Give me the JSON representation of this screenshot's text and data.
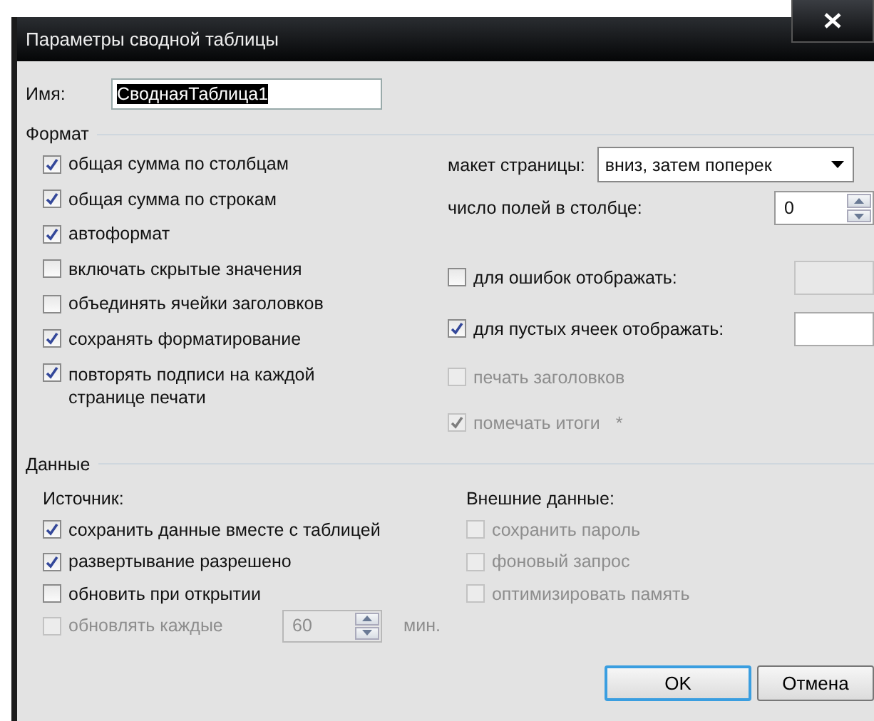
{
  "window": {
    "title": "Параметры сводной таблицы"
  },
  "name_field": {
    "label": "Имя:",
    "value": "СводнаяТаблица1",
    "selected": true
  },
  "format": {
    "title": "Формат",
    "left_options": [
      {
        "label": "общая сумма по столбцам",
        "checked": true,
        "disabled": false
      },
      {
        "label": "общая сумма по строкам",
        "checked": true,
        "disabled": false
      },
      {
        "label": "автоформат",
        "checked": true,
        "disabled": false
      },
      {
        "label": "включать скрытые значения",
        "checked": false,
        "disabled": false
      },
      {
        "label": "объединять ячейки заголовков",
        "checked": false,
        "disabled": false
      },
      {
        "label": "сохранять форматирование",
        "checked": true,
        "disabled": false
      },
      {
        "label": "повторять подписи на каждой странице печати",
        "checked": true,
        "disabled": false
      }
    ],
    "right_options": [
      {
        "kind": "select",
        "label": "макет страницы:",
        "value": "вниз, затем поперек"
      },
      {
        "kind": "spin",
        "label": "число полей в столбце:",
        "value": "0"
      },
      {
        "kind": "checkfield",
        "label": "для ошибок отображать:",
        "checked": false,
        "disabled": false,
        "field_disabled": true
      },
      {
        "kind": "checkfield",
        "label": "для пустых ячеек отображать:",
        "checked": true,
        "disabled": false,
        "field_disabled": false
      },
      {
        "kind": "check",
        "label": "печать заголовков",
        "checked": false,
        "disabled": true
      },
      {
        "kind": "check",
        "label": "помечать итоги",
        "checked": true,
        "disabled": true,
        "note": "*"
      }
    ]
  },
  "data": {
    "title": "Данные",
    "source": {
      "label": "Источник:",
      "options": [
        {
          "label": "сохранить данные вместе с таблицей",
          "checked": true,
          "disabled": false
        },
        {
          "label": "развертывание разрешено",
          "checked": true,
          "disabled": false
        },
        {
          "label": "обновить при открытии",
          "checked": false,
          "disabled": false
        }
      ]
    },
    "refresh": {
      "label": "обновлять каждые",
      "checked": false,
      "disabled": true,
      "value": "60",
      "unit": "мин."
    },
    "external": {
      "label": "Внешние данные:",
      "options": [
        {
          "label": "сохранить пароль",
          "checked": false,
          "disabled": true
        },
        {
          "label": "фоновый запрос",
          "checked": false,
          "disabled": true
        },
        {
          "label": "оптимизировать память",
          "checked": false,
          "disabled": true
        }
      ]
    }
  },
  "buttons": [
    {
      "label": "OK",
      "default": true
    },
    {
      "label": "Отмена",
      "default": false
    }
  ]
}
